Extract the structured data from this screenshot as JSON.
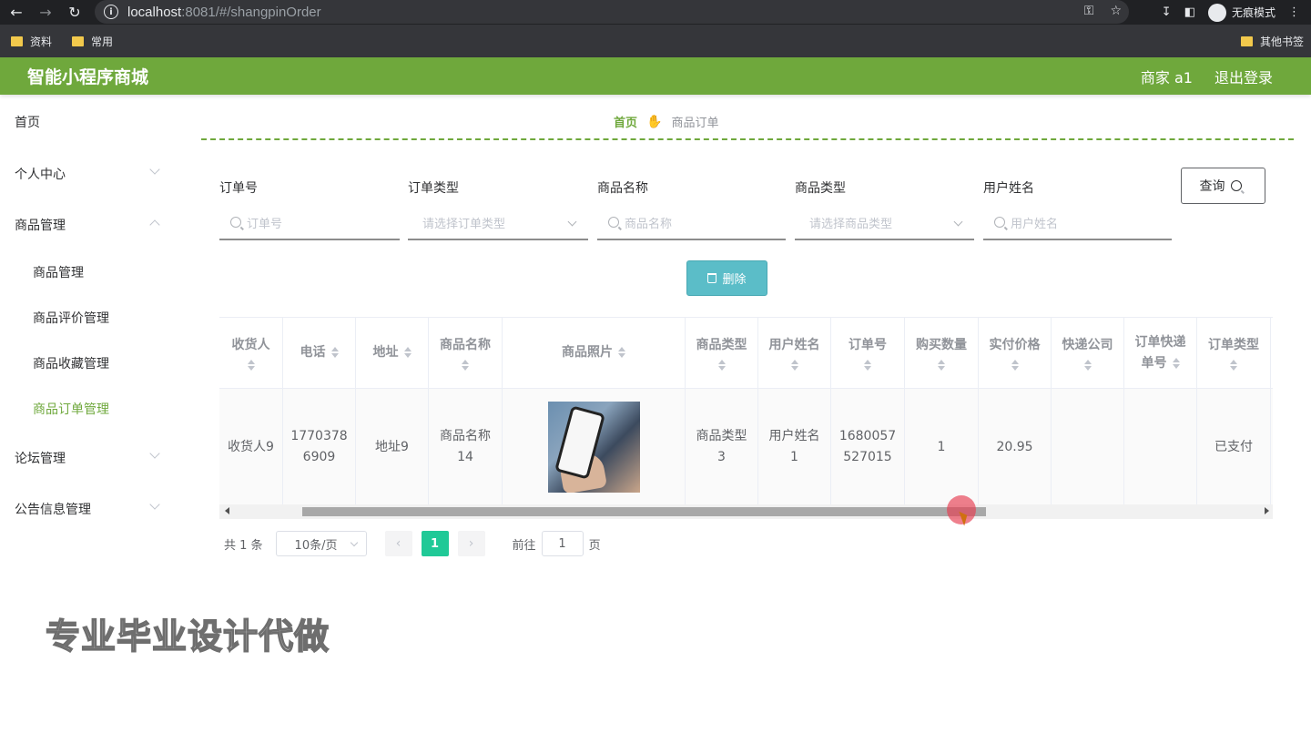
{
  "browser": {
    "url_host": "localhost",
    "url_path": ":8081/#/shangpinOrder",
    "incognito_label": "无痕模式",
    "bookmarks": [
      "资料",
      "常用"
    ],
    "other_bookmarks": "其他书签"
  },
  "app": {
    "title": "智能小程序商城",
    "user": "商家 a1",
    "logout": "退出登录"
  },
  "sidebar": {
    "items": [
      {
        "label": "首页"
      },
      {
        "label": "个人中心"
      },
      {
        "label": "商品管理"
      },
      {
        "label": "商品管理"
      },
      {
        "label": "商品评价管理"
      },
      {
        "label": "商品收藏管理"
      },
      {
        "label": "商品订单管理"
      },
      {
        "label": "论坛管理"
      },
      {
        "label": "公告信息管理"
      }
    ]
  },
  "breadcrumb": {
    "home": "首页",
    "current": "商品订单"
  },
  "filters": [
    {
      "label": "订单号",
      "placeholder": "订单号"
    },
    {
      "label": "订单类型",
      "placeholder": "请选择订单类型"
    },
    {
      "label": "商品名称",
      "placeholder": "商品名称"
    },
    {
      "label": "商品类型",
      "placeholder": "请选择商品类型"
    },
    {
      "label": "用户姓名",
      "placeholder": "用户姓名"
    }
  ],
  "buttons": {
    "query": "查询",
    "delete": "删除"
  },
  "table": {
    "headers": [
      "收货人",
      "电话",
      "地址",
      "商品名称",
      "商品照片",
      "商品类型",
      "用户姓名",
      "订单号",
      "购买数量",
      "实付价格",
      "快递公司",
      "订单快递",
      "单号",
      "订单类型"
    ],
    "row": {
      "receiver": "收货人9",
      "phone_1": "1770378",
      "phone_2": "6909",
      "address": "地址9",
      "product_name_1": "商品名称",
      "product_name_2": "14",
      "product_type_1": "商品类型",
      "product_type_2": "3",
      "user_name_1": "用户姓名",
      "user_name_2": "1",
      "order_no_1": "1680057",
      "order_no_2": "527015",
      "quantity": "1",
      "price": "20.95",
      "express": "",
      "express_no": "",
      "order_type": "已支付"
    }
  },
  "pagination": {
    "total": "共 1 条",
    "page_size": "10条/页",
    "current_page": "1",
    "goto_label": "前往",
    "goto_value": "1",
    "page_unit": "页"
  },
  "watermark": "专业毕业设计代做",
  "colors": {
    "accent": "#6fa83c",
    "delete_button": "#5bbdc8",
    "active_page": "#20c997"
  }
}
